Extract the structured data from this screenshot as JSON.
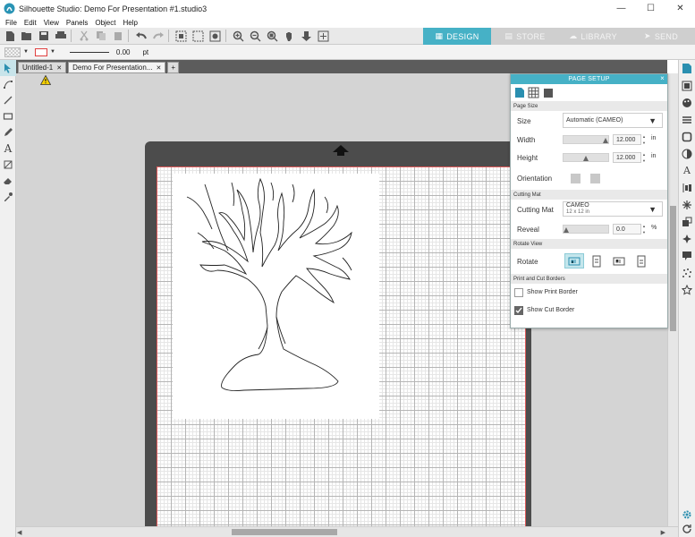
{
  "window": {
    "title": "Silhouette Studio: Demo For Presentation #1.studio3",
    "controls": [
      "—",
      "☐",
      "✕"
    ]
  },
  "menu": [
    "File",
    "Edit",
    "View",
    "Panels",
    "Object",
    "Help"
  ],
  "modes": [
    {
      "label": "DESIGN",
      "active": true
    },
    {
      "label": "STORE",
      "active": false
    },
    {
      "label": "LIBRARY",
      "active": false
    },
    {
      "label": "SEND",
      "active": false
    }
  ],
  "linebar": {
    "line_width": "0.00",
    "unit": "pt"
  },
  "tabs": [
    {
      "label": "Untitled-1",
      "active": false
    },
    {
      "label": "Demo For Presentation...",
      "active": true
    }
  ],
  "add_tab": "+",
  "panel": {
    "title": "PAGE SETUP",
    "close": "×",
    "sections": {
      "page_size": "Page Size",
      "cutting_mat": "Cutting Mat",
      "rotate_view": "Rotate View",
      "borders": "Print and Cut Borders"
    },
    "size_label": "Size",
    "size_value": "Automatic (CAMEO)",
    "width_label": "Width",
    "width_value": "12.000",
    "height_label": "Height",
    "height_value": "12.000",
    "length_unit": "in",
    "orientation_label": "Orientation",
    "mat_label": "Cutting Mat",
    "mat_name": "CAMEO",
    "mat_size": "12 x 12 in",
    "reveal_label": "Reveal",
    "reveal_value": "0.0",
    "reveal_unit": "%",
    "rotate_label": "Rotate",
    "show_print_border": "Show Print Border",
    "show_cut_border": "Show Cut Border",
    "print_border_checked": false,
    "cut_border_checked": true
  },
  "colors": {
    "accent": "#46b1c6",
    "cut_border": "#e05a5a"
  }
}
